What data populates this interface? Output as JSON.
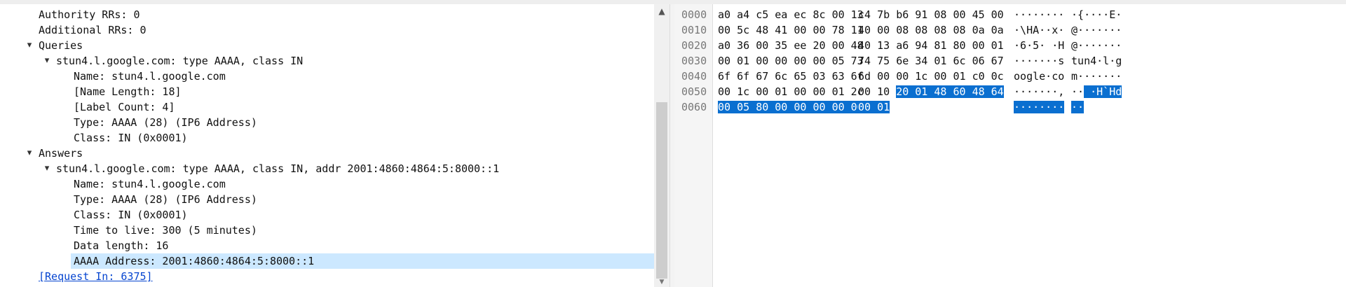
{
  "packet_details": {
    "rows": [
      {
        "text": "Authority RRs: 0",
        "expander": ""
      },
      {
        "text": "Additional RRs: 0",
        "expander": ""
      },
      {
        "text": "Queries",
        "expander": "▾"
      },
      {
        "text": "stun4.l.google.com: type AAAA, class IN",
        "expander": "▾"
      },
      {
        "text": "Name: stun4.l.google.com",
        "expander": ""
      },
      {
        "text": "[Name Length: 18]",
        "expander": ""
      },
      {
        "text": "[Label Count: 4]",
        "expander": ""
      },
      {
        "text": "Type: AAAA (28) (IP6 Address)",
        "expander": ""
      },
      {
        "text": "Class: IN (0x0001)",
        "expander": ""
      },
      {
        "text": "Answers",
        "expander": "▾"
      },
      {
        "text": "stun4.l.google.com: type AAAA, class IN, addr 2001:4860:4864:5:8000::1",
        "expander": "▾"
      },
      {
        "text": "Name: stun4.l.google.com",
        "expander": ""
      },
      {
        "text": "Type: AAAA (28) (IP6 Address)",
        "expander": ""
      },
      {
        "text": "Class: IN (0x0001)",
        "expander": ""
      },
      {
        "text": "Time to live: 300 (5 minutes)",
        "expander": ""
      },
      {
        "text": "Data length: 16",
        "expander": ""
      },
      {
        "text": "AAAA Address: 2001:4860:4864:5:8000::1",
        "expander": "",
        "selected": true
      },
      {
        "text": "[Request In: 6375]",
        "expander": "",
        "link": true
      }
    ]
  },
  "scrollbar": {
    "up_arrow": "▲",
    "down_arrow": "▼"
  },
  "packet_bytes": {
    "rows": [
      {
        "offset": "0000",
        "hex_a": "a0 a4 c5 ea ec 8c 00 13",
        "hex_b": "c4 7b b6 91 08 00 45 00",
        "ascii_a": "········",
        "ascii_b": "·{····E·",
        "hl_from": -1
      },
      {
        "offset": "0010",
        "hex_a": "00 5c 48 41 00 00 78 11",
        "hex_b": "40 00 08 08 08 08 0a 0a",
        "ascii_a": "·\\HA··x·",
        "ascii_b": "@·······",
        "hl_from": -1
      },
      {
        "offset": "0020",
        "hex_a": "a0 36 00 35 ee 20 00 48",
        "hex_b": "40 13 a6 94 81 80 00 01",
        "ascii_a": "·6·5· ·H",
        "ascii_b": "@·······",
        "hl_from": -1
      },
      {
        "offset": "0030",
        "hex_a": "00 01 00 00 00 00 05 73",
        "hex_b": "74 75 6e 34 01 6c 06 67",
        "ascii_a": "·······s",
        "ascii_b": "tun4·l·g",
        "hl_from": -1
      },
      {
        "offset": "0040",
        "hex_a": "6f 6f 67 6c 65 03 63 6f",
        "hex_b": "6d 00 00 1c 00 01 c0 0c",
        "ascii_a": "oogle·co",
        "ascii_b": "m·······",
        "hl_from": -1
      },
      {
        "offset": "0050",
        "hex_a": "00 1c 00 01 00 00 01 2c",
        "hex_b": "00 10 20 01 48 60 48 64",
        "ascii_a": "·······,",
        "ascii_b": "·· ·H`Hd",
        "hl_from": 10
      },
      {
        "offset": "0060",
        "hex_a": "00 05 80 00 00 00 00 00",
        "hex_b": "00 01",
        "ascii_a": "········",
        "ascii_b": "··",
        "hl_from": 0
      }
    ]
  },
  "colors": {
    "selection": "#cce8ff",
    "byte_highlight": "#0a6fd0",
    "link": "#0645d0"
  }
}
